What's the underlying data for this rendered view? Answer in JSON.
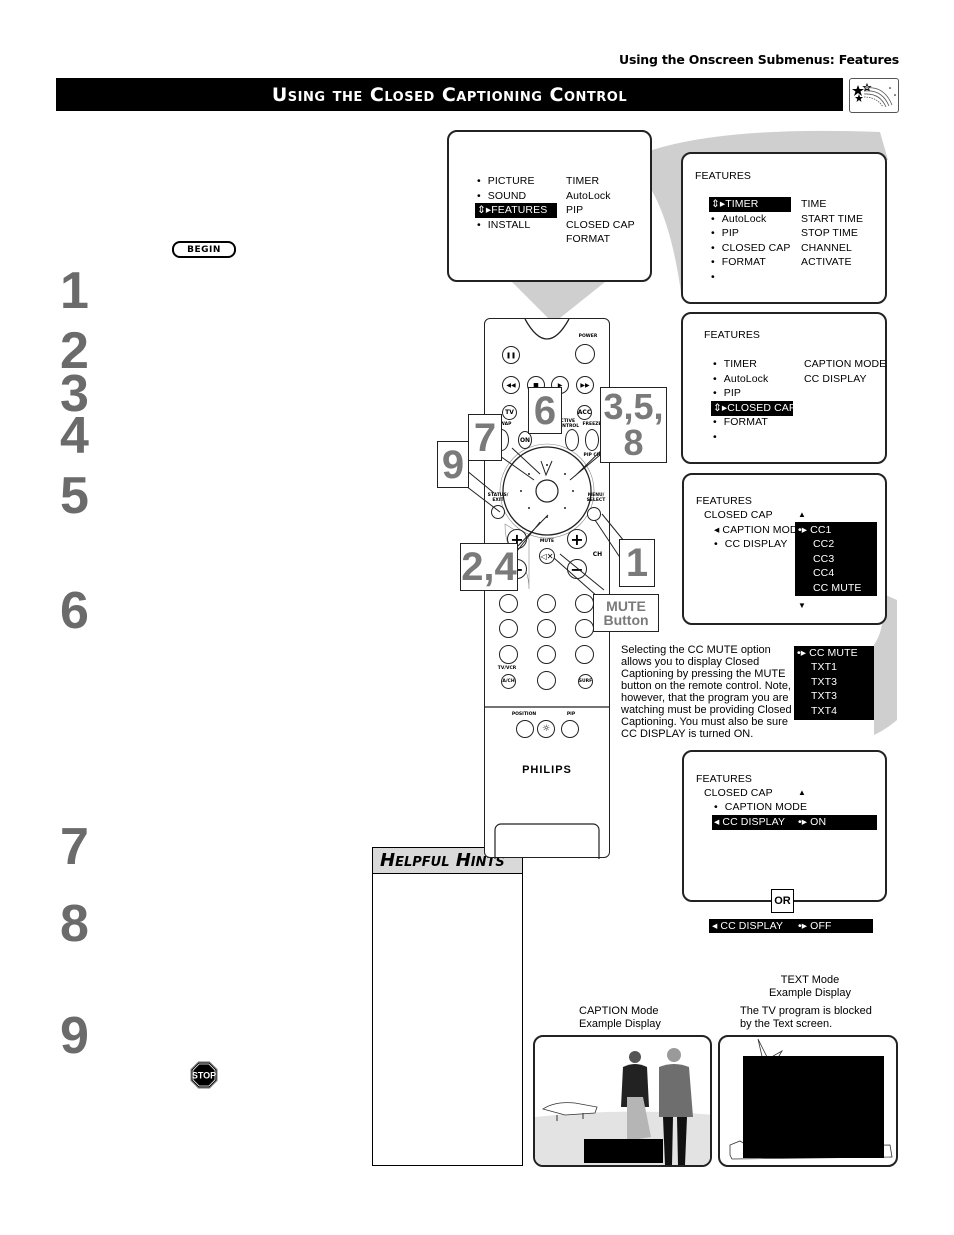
{
  "header": {
    "running_head": "Using the Onscreen Submenus: Features",
    "title": "Using the Closed Captioning Control",
    "icon": "features-stars-icon"
  },
  "steps": {
    "begin_label": "BEGIN",
    "numbers": [
      "1",
      "2",
      "3",
      "4",
      "5",
      "6",
      "7",
      "8",
      "9"
    ],
    "stop_label": "STOP"
  },
  "helpful_hints": {
    "title": "Helpful Hints"
  },
  "main_menu": {
    "left": [
      "PICTURE",
      "SOUND",
      "FEATURES",
      "INSTALL"
    ],
    "right": [
      "TIMER",
      "AutoLock",
      "PIP",
      "CLOSED CAP",
      "FORMAT"
    ],
    "selected": "FEATURES"
  },
  "features_menu_1": {
    "title": "FEATURES",
    "left": [
      "TIMER",
      "AutoLock",
      "PIP",
      "CLOSED CAP",
      "FORMAT",
      ""
    ],
    "right": [
      "TIME",
      "START TIME",
      "STOP TIME",
      "CHANNEL",
      "ACTIVATE"
    ],
    "selected": "TIMER"
  },
  "features_menu_2": {
    "title": "FEATURES",
    "left": [
      "TIMER",
      "AutoLock",
      "PIP",
      "CLOSED CAP",
      "FORMAT",
      ""
    ],
    "right": [
      "CAPTION MODE",
      "CC DISPLAY"
    ],
    "selected": "CLOSED CAP"
  },
  "caption_mode_menu": {
    "title": "FEATURES",
    "subtitle": "CLOSED CAP",
    "items": [
      "CAPTION MODE",
      "CC DISPLAY"
    ],
    "options": [
      "CC1",
      "CC2",
      "CC3",
      "CC4",
      "CC MUTE"
    ],
    "extended_options": [
      "CC MUTE",
      "TXT1",
      "TXT3",
      "TXT3",
      "TXT4"
    ]
  },
  "cc_mute_note": "Selecting the CC MUTE option allows you to display Closed Captioning by pressing the MUTE button on the remote control. Note, however, that the program you are watching must be providing Closed Captioning. You must also be sure CC DISPLAY is turned ON.",
  "cc_display_menu": {
    "title": "FEATURES",
    "subtitle": "CLOSED CAP",
    "items": [
      "CAPTION MODE",
      "CC DISPLAY"
    ],
    "value_on": "ON",
    "or_label": "OR",
    "off_row_label": "CC DISPLAY",
    "value_off": "OFF"
  },
  "examples": {
    "caption_label_1": "CAPTION Mode",
    "caption_label_2": "Example Display",
    "text_label_1": "TEXT Mode",
    "text_label_2": "Example Display",
    "text_desc_1": "The TV program is blocked",
    "text_desc_2": "by the Text screen."
  },
  "remote": {
    "brand": "PHILIPS",
    "labels": {
      "power": "POWER",
      "tv": "TV",
      "acc": "ACC",
      "swap": "SWAP",
      "on": "ON",
      "active_control": "ACTIVE CONTROL",
      "freeze": "FREEZE",
      "pip_ch": "PIP CH",
      "status_exit": "STATUS/ EXIT",
      "menu_select": "MENU/ SELECT",
      "mute": "MUTE",
      "ch": "CH",
      "tv_vcr": "TV/VCR",
      "a_ch": "A/CH",
      "surf": "SURF",
      "position": "POSITION",
      "pip": "PIP"
    },
    "callouts": [
      "9",
      "7",
      "6",
      "3,5, 8",
      "2,4",
      "1"
    ],
    "mute_callout_1": "MUTE",
    "mute_callout_2": "Button"
  }
}
